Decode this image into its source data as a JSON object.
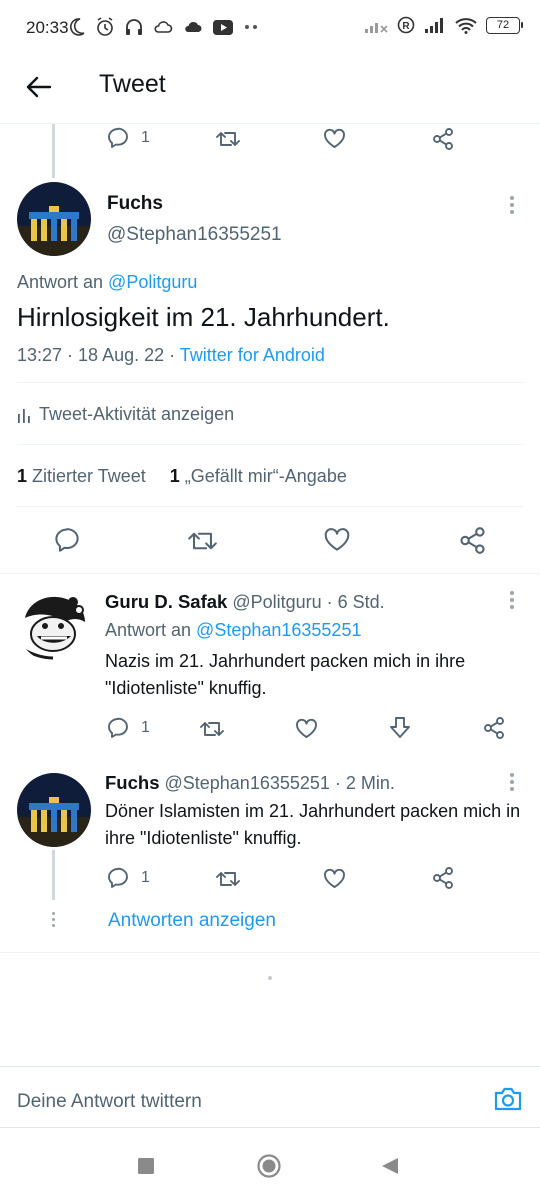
{
  "status_bar": {
    "time": "20:33",
    "battery": "72",
    "left_icons": [
      "moon-icon",
      "alarm-icon",
      "headphones-icon",
      "cloud-icon",
      "cloud-filled-icon",
      "youtube-icon",
      "dots-icon"
    ],
    "right_icons": [
      "no-signal-icon",
      "registered-icon",
      "signal-icon",
      "wifi-icon",
      "battery-icon"
    ]
  },
  "header": {
    "title": "Tweet"
  },
  "prev_tweet_actions": {
    "reply_count": "1"
  },
  "main_tweet": {
    "name": "Fuchs",
    "handle": "@Stephan16355251",
    "reply_prefix": "Antwort an ",
    "reply_to": "@Politguru",
    "text": "Hirnlosigkeit im 21. Jahrhundert.",
    "time": "13:27 · 18 Aug. 22 · ",
    "source": "Twitter for Android",
    "activity": "Tweet-Aktivität anzeigen",
    "quote_count": "1",
    "quote_label": " Zitierter Tweet",
    "like_count": "1",
    "like_label": " „Gefällt mir“-Angabe"
  },
  "reply1": {
    "name": "Guru D. Safak",
    "handle_time": " @Politguru · 6 Std.",
    "reply_prefix": "Antwort an ",
    "reply_to": "@Stephan16355251",
    "text": "Nazis im 21. Jahrhundert packen mich in ihre \"Idiotenliste\" knuffig.",
    "reply_count": "1"
  },
  "reply2": {
    "name": "Fuchs",
    "handle_time": " @Stephan16355251 · 2 Min.",
    "text": "Döner Islamisten im 21. Jahrhundert packen mich in ihre \"Idiotenliste\" knuffig.",
    "reply_count": "1"
  },
  "show_replies": "Antworten anzeigen",
  "compose": {
    "placeholder": "Deine Antwort twittern"
  },
  "colors": {
    "accent": "#1d9bf0",
    "secondary_text": "#536471",
    "divider": "#eff3f4"
  }
}
